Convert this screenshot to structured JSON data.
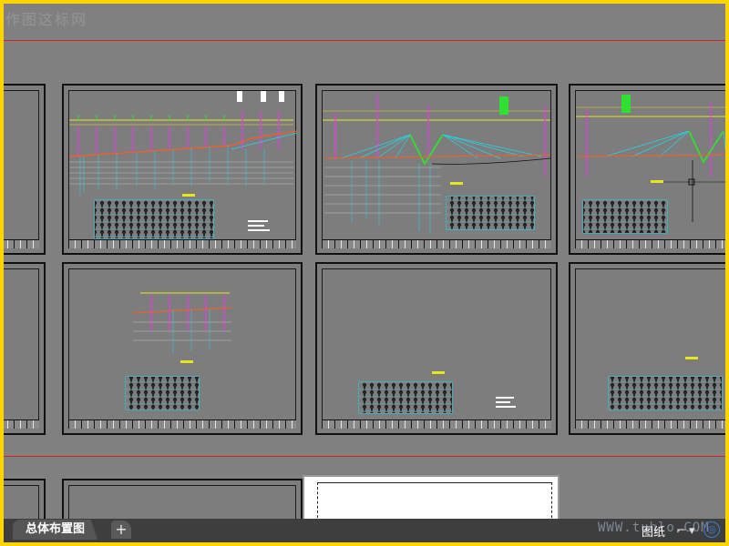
{
  "watermark": "作图这标网",
  "layout_tabs": [
    {
      "label": "总体布置图",
      "active": true
    }
  ],
  "add_tab_symbol": "+",
  "status": {
    "paper_label": "图纸",
    "watermark_url": "WWW.tuhlo.COM"
  },
  "icons": {
    "add": "plus-icon",
    "tool": "snap-icon",
    "zoom": "zoom-icon"
  },
  "colors": {
    "canvas": "#808080",
    "border": "#ffd400",
    "accent_cyan": "#20d8e8",
    "accent_magenta": "#e040e0",
    "accent_yellow": "#e6e620",
    "accent_green": "#30e030",
    "guide_red": "#d32222"
  }
}
